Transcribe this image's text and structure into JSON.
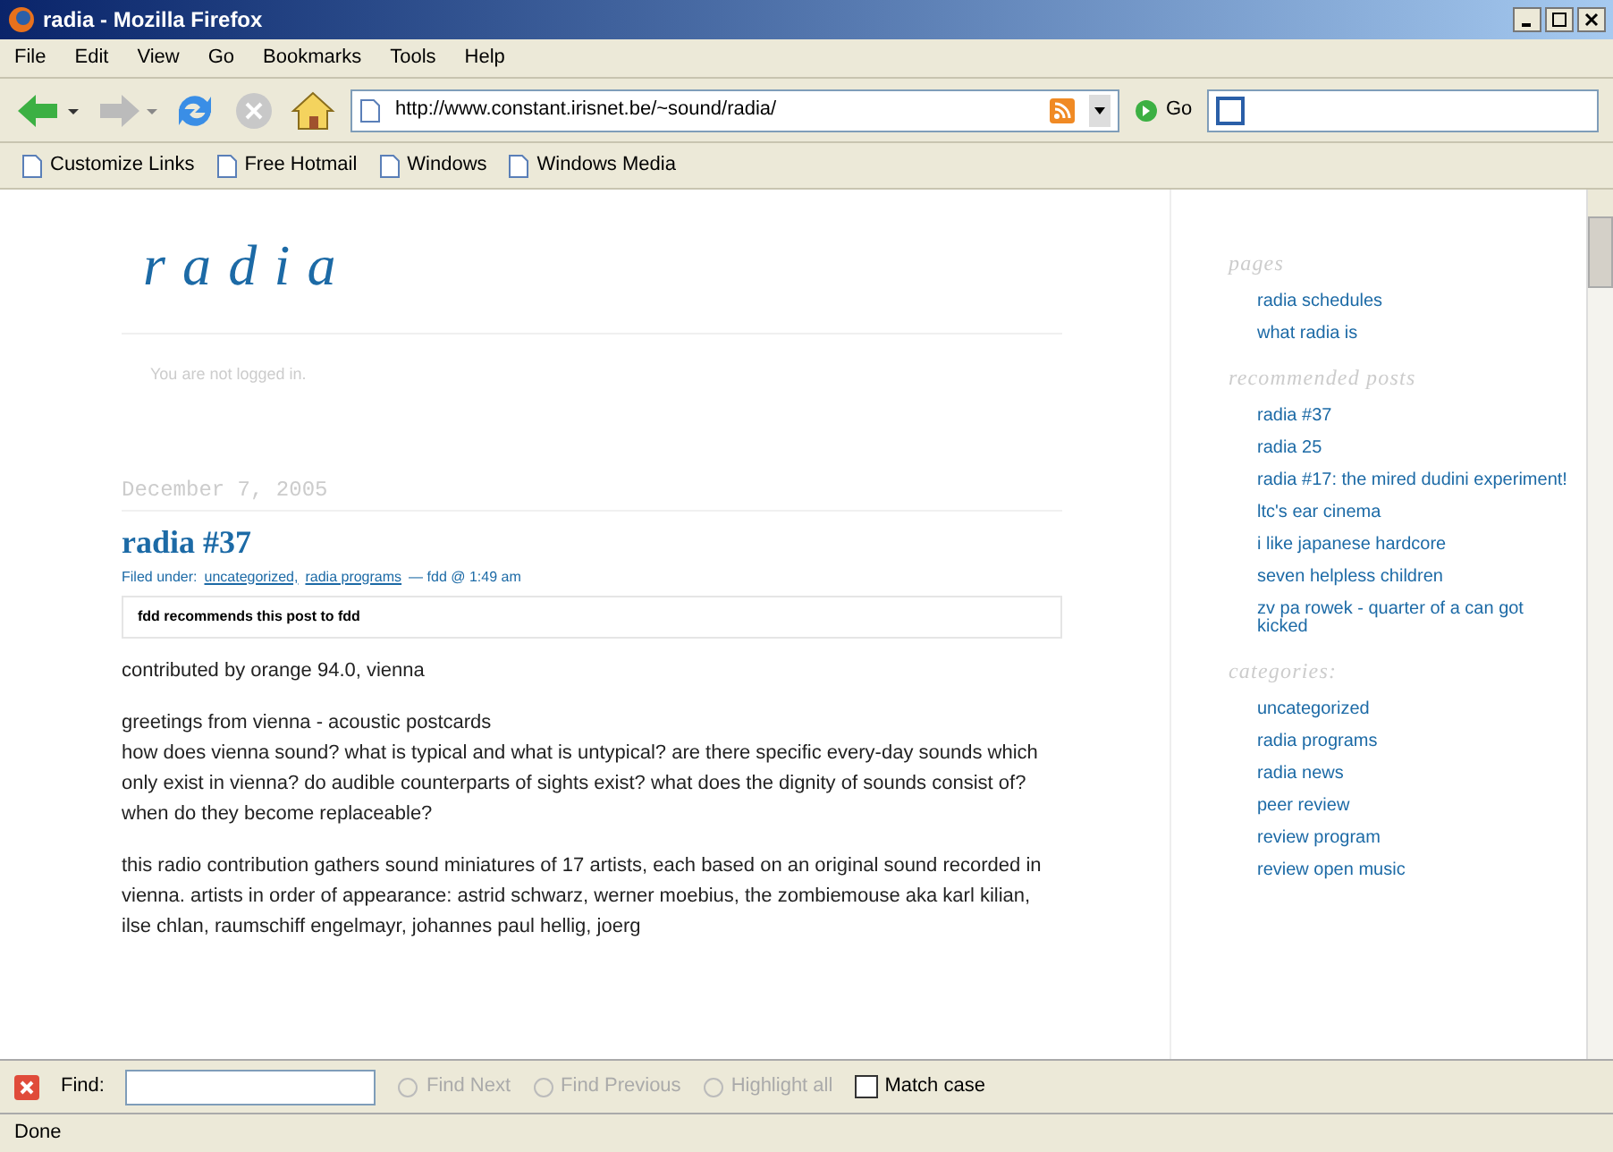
{
  "window": {
    "title": "radia - Mozilla Firefox"
  },
  "menu": [
    "File",
    "Edit",
    "View",
    "Go",
    "Bookmarks",
    "Tools",
    "Help"
  ],
  "address": {
    "value": "http://www.constant.irisnet.be/~sound/radia/"
  },
  "go_label": "Go",
  "bookmarks": [
    "Customize Links",
    "Free Hotmail",
    "Windows",
    "Windows Media"
  ],
  "page": {
    "site_title": "radia",
    "login_note": "You are not logged in.",
    "post": {
      "date": "December 7, 2005",
      "title": "radia #37",
      "filed_prefix": "Filed under:",
      "filed_links": [
        "uncategorized,",
        "radia programs"
      ],
      "filed_suffix": "— fdd @ 1:49 am",
      "recommend": "fdd recommends this post to fdd",
      "paragraphs": [
        "contributed by orange 94.0, vienna",
        "greetings from vienna - acoustic postcards\nhow does vienna sound? what is typical and what is untypical? are there specific every-day sounds which only exist in vienna? do audible counterparts of sights exist? what does the dignity of sounds consist of? when do they become replaceable?",
        "this radio contribution gathers sound miniatures of 17 artists, each based on an original sound recorded in vienna. artists in order of appearance: astrid schwarz, werner moebius, the zombiemouse aka karl kilian, ilse chlan, raumschiff engelmayr, johannes paul hellig, joerg"
      ]
    }
  },
  "sidebar": [
    {
      "heading": "pages",
      "items": [
        "radia schedules",
        "what radia is"
      ]
    },
    {
      "heading": "recommended posts",
      "items": [
        "radia #37",
        "radia 25",
        "radia #17: the mired dudini experiment!",
        "ltc's ear cinema",
        "i like japanese hardcore",
        "seven helpless children",
        "zv pa rowek - quarter of a can got kicked"
      ]
    },
    {
      "heading": "categories:",
      "items": [
        "uncategorized",
        "radia programs",
        "radia news",
        "peer review",
        "review program",
        "review open music"
      ]
    }
  ],
  "find_bar": {
    "label": "Find:",
    "buttons": [
      {
        "label": "Find Next",
        "disabled": true
      },
      {
        "label": "Find Previous",
        "disabled": true
      },
      {
        "label": "Highlight all",
        "disabled": true
      }
    ],
    "match_case": {
      "label": "Match case",
      "checked": false
    }
  },
  "status_bar": "Done"
}
